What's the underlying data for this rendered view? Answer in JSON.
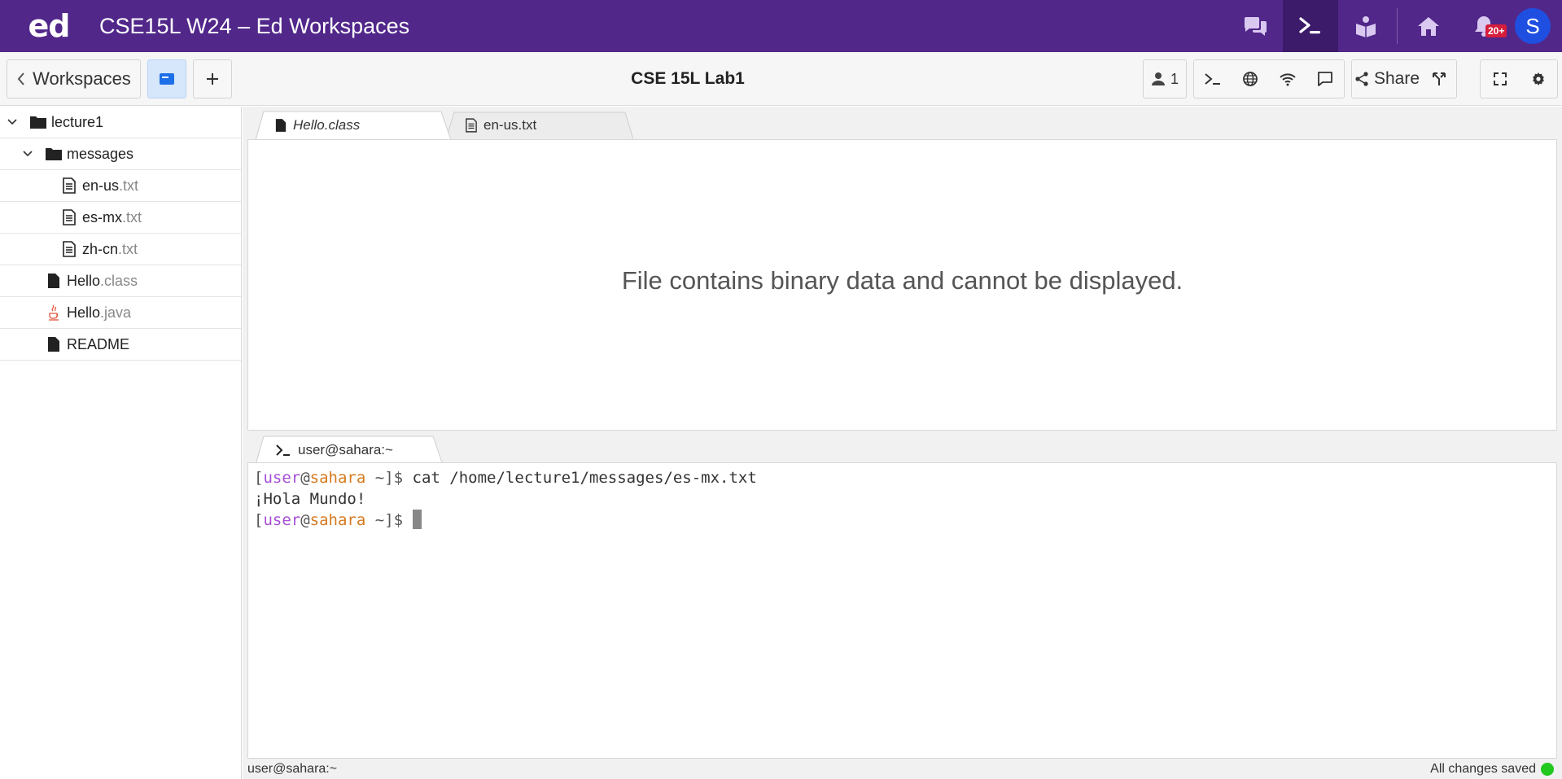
{
  "header": {
    "logo": "ed",
    "title": "CSE15L W24 – Ed Workspaces",
    "notifications_badge": "20+",
    "avatar_initial": "S",
    "icons": [
      "discussion-icon",
      "terminal-icon",
      "lessons-icon",
      "home-icon",
      "bell-icon"
    ]
  },
  "toolbar": {
    "back_label": "Workspaces",
    "workspace_title": "CSE 15L Lab1",
    "users_count": "1",
    "share_label": "Share"
  },
  "sidebar": {
    "items": [
      {
        "name": "lecture1",
        "ext": "",
        "type": "folder",
        "depth": 0
      },
      {
        "name": "messages",
        "ext": "",
        "type": "folder",
        "depth": 1
      },
      {
        "name": "en-us",
        "ext": ".txt",
        "type": "text",
        "depth": 2
      },
      {
        "name": "es-mx",
        "ext": ".txt",
        "type": "text",
        "depth": 2
      },
      {
        "name": "zh-cn",
        "ext": ".txt",
        "type": "text",
        "depth": 2
      },
      {
        "name": "Hello",
        "ext": ".class",
        "type": "binary",
        "depth": 1
      },
      {
        "name": "Hello",
        "ext": ".java",
        "type": "java",
        "depth": 1
      },
      {
        "name": "README",
        "ext": "",
        "type": "binary",
        "depth": 1
      }
    ]
  },
  "editor": {
    "tabs": [
      {
        "label": "Hello.class",
        "active": true
      },
      {
        "label": "en-us.txt",
        "active": false
      }
    ],
    "message": "File contains binary data and cannot be displayed."
  },
  "terminal": {
    "tab_label": "user@sahara:~",
    "user": "user",
    "host": "sahara",
    "prompt_dir": "~",
    "command": "cat /home/lecture1/messages/es-mx.txt",
    "output": "¡Hola Mundo!"
  },
  "status": {
    "left": "user@sahara:~",
    "right": "All changes saved",
    "ok_color": "#21c91f"
  },
  "colors": {
    "brand": "#51278a",
    "accent": "#1f4fe0",
    "terminal_user": "#a54fd6",
    "terminal_host": "#d67a20"
  }
}
